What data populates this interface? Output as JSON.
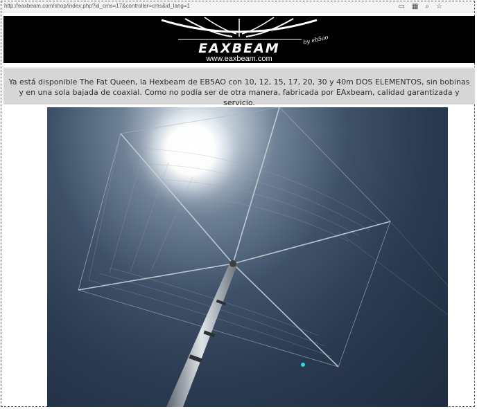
{
  "browser": {
    "url": "http://eaxbeam.com/shop/index.php?id_cms=17&controller=cms&id_lang=1",
    "icons": [
      "reader-icon",
      "qr-code-icon",
      "zoom-icon",
      "bookmark-star-icon"
    ]
  },
  "header": {
    "brand": "EAXBEAM",
    "tagline": "by eb5ao",
    "site_url": "www.eaxbeam.com",
    "background_color": "#000000",
    "text_color": "#ffffff"
  },
  "announcement": {
    "text": "Ya está disponible The Fat Queen, la Hexbeam de EB5AO con 10, 12, 15, 17, 20, 30 y 40m DOS ELEMENTOS, sin bobinas y en una sola bajada de coaxial. Como no podía ser de otra manera, fabricada por EAxbeam, calidad garantizada y servicio.",
    "background_color": "#d6d6d6"
  }
}
